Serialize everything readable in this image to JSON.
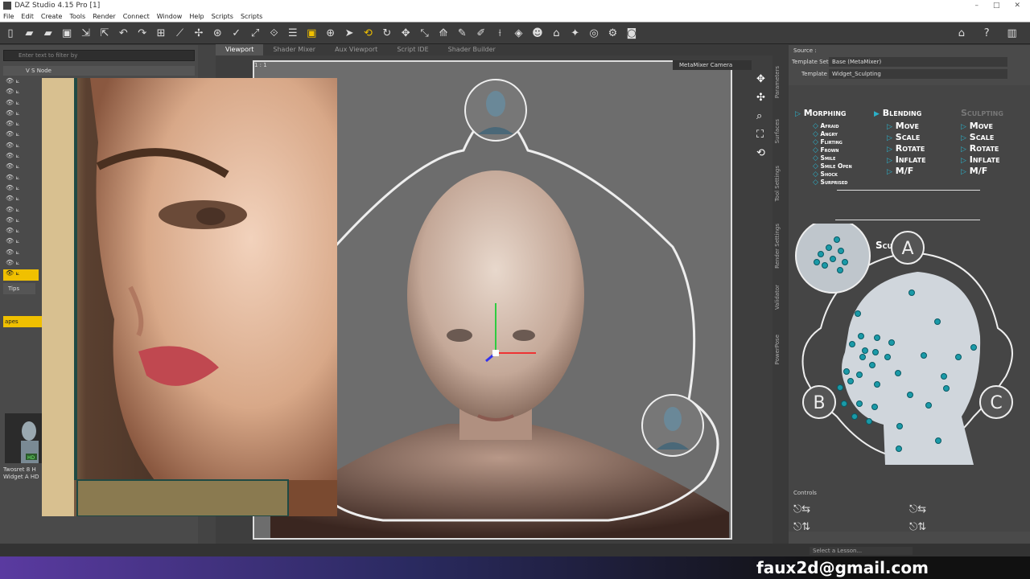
{
  "window": {
    "title": "DAZ Studio 4.15 Pro [1]"
  },
  "menu": [
    "File",
    "Edit",
    "Create",
    "Tools",
    "Render",
    "Connect",
    "Window",
    "Help",
    "Scripts",
    "Scripts"
  ],
  "left_panel": {
    "filter_placeholder": "Enter text to filter by",
    "col_v": "V",
    "col_s": "S",
    "col_node": "Node",
    "tips_tab": "Tips",
    "selected_item": "apes",
    "thumb_badge": "HD",
    "thumb_label": "Twosret 8 H Widget A HD"
  },
  "viewport": {
    "tabs": [
      "Viewport",
      "Shader Mixer",
      "Aux Viewport",
      "Script IDE",
      "Shader Builder"
    ],
    "active_tab": "Viewport",
    "camera": "MetaMixer Camera",
    "zoom": "1 : 1"
  },
  "right_panel": {
    "side_tabs": [
      "Parameters",
      "Surfaces",
      "Tool Settings",
      "Render Settings",
      "Validator",
      "PowerPose"
    ],
    "source_label": "Source :",
    "template_set_label": "Template Set :",
    "template_set_value": "Base (MetaMixer)",
    "template_label": "Template :",
    "template_value": "Widget_Sculpting",
    "columns": {
      "morphing": "Morphing",
      "blending": "Blending",
      "sculpting": "Sculpting"
    },
    "morph_items": [
      "Afraid",
      "Angry",
      "Flirting",
      "Frown",
      "Smile",
      "Smile Open",
      "Shock",
      "Surprised"
    ],
    "actions": [
      "Move",
      "Scale",
      "Rotate",
      "Inflate",
      "M/F"
    ],
    "section_title": "Sculpting",
    "zone_labels": [
      "A",
      "B",
      "C"
    ],
    "controls_label": "Controls",
    "lesson_placeholder": "Select a Lesson..."
  },
  "watermark": "faux2d@gmail.com",
  "colors": {
    "accent": "#f0c000",
    "dot": "#1a9aa8",
    "panel": "#4a4a4a"
  }
}
